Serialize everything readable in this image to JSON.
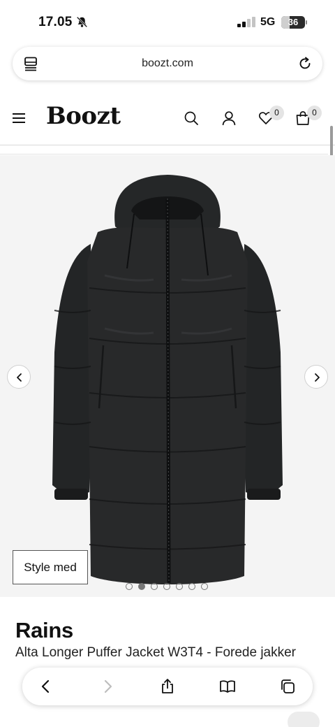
{
  "status_bar": {
    "time": "17.05",
    "network": "5G",
    "battery": "36",
    "battery_level": 0.36,
    "icons": [
      "bell-muted-icon",
      "cellular-signal-icon"
    ]
  },
  "browser": {
    "url": "boozt.com",
    "icons": [
      "tabs-menu-icon",
      "reload-icon"
    ]
  },
  "header": {
    "logo": "Boozt",
    "wishlist_count": "0",
    "cart_count": "0",
    "icons": [
      "hamburger-icon",
      "search-icon",
      "user-icon",
      "heart-icon",
      "bag-icon"
    ]
  },
  "gallery": {
    "style_button": "Style med",
    "image_count": 7,
    "active_index": 1,
    "icons": [
      "chevron-left-icon",
      "chevron-right-icon"
    ]
  },
  "product": {
    "brand": "Rains",
    "name": "Alta Longer Puffer Jacket W3T4 - Forede jakker"
  },
  "toolbar": {
    "icons": [
      "back-icon",
      "forward-icon",
      "share-icon",
      "bookmarks-icon",
      "tabs-icon"
    ]
  },
  "colors": {
    "jacket": "#262829",
    "gallery_bg": "#f4f4f4",
    "badge_bg": "#e4e4e4"
  }
}
